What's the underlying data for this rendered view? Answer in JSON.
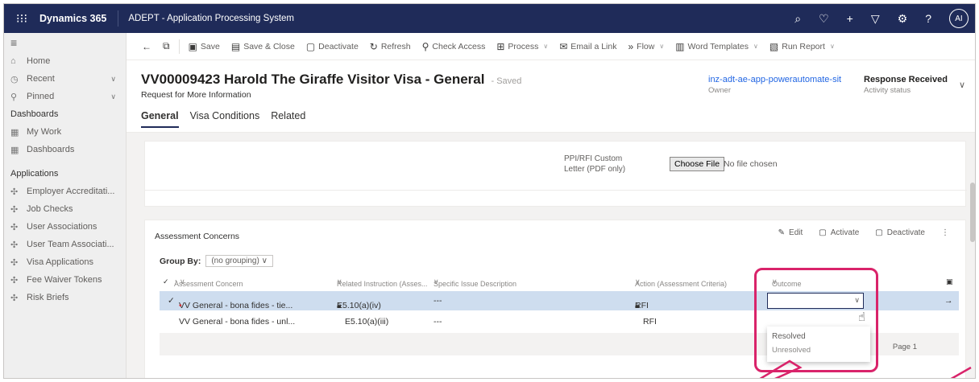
{
  "topbar": {
    "brand": "Dynamics 365",
    "app_name": "ADEPT - Application Processing System",
    "avatar_initials": "AI"
  },
  "nav": {
    "home": "Home",
    "recent": "Recent",
    "pinned": "Pinned",
    "dashboards_heading": "Dashboards",
    "my_work": "My Work",
    "dashboards": "Dashboards",
    "applications_heading": "Applications",
    "items": [
      "Employer Accreditati...",
      "Job Checks",
      "User Associations",
      "User Team Associati...",
      "Visa Applications",
      "Fee Waiver Tokens",
      "Risk Briefs"
    ]
  },
  "commands": {
    "save": "Save",
    "save_close": "Save & Close",
    "deactivate": "Deactivate",
    "refresh": "Refresh",
    "check_access": "Check Access",
    "process": "Process",
    "email_link": "Email a Link",
    "flow": "Flow",
    "word_templates": "Word Templates",
    "run_report": "Run Report"
  },
  "header": {
    "title": "VV00009423 Harold The Giraffe Visitor Visa - General",
    "saved": "- Saved",
    "subtitle": "Request for More Information",
    "owner_value": "inz-adt-ae-app-powerautomate-sit",
    "owner_label": "Owner",
    "status_value": "Response Received",
    "status_label": "Activity status"
  },
  "tabs": [
    "General",
    "Visa Conditions",
    "Related"
  ],
  "form": {
    "ppi_label_1": "PPI/RFI Custom",
    "ppi_label_2": "Letter (PDF only)",
    "choose_file": "Choose File",
    "no_file": "No file chosen"
  },
  "grid": {
    "title": "Assessment Concerns",
    "edit": "Edit",
    "activate": "Activate",
    "deactivate": "Deactivate",
    "group_by_label": "Group By:",
    "group_by_value": "(no grouping)",
    "columns": {
      "concern": "Assessment Concern",
      "instruction": "Related Instruction (Asses...",
      "description": "Specific Issue Description",
      "action": "Action (Assessment Criteria)",
      "outcome": "Outcome"
    },
    "rows": [
      {
        "concern": "VV General - bona fides - tie...",
        "instruction": "E5.10(a)(iv)",
        "description": "---",
        "action": "RFI"
      },
      {
        "concern": "VV General - bona fides - unl...",
        "instruction": "E5.10(a)(iii)",
        "description": "---",
        "action": "RFI"
      }
    ],
    "page": "Page 1",
    "outcome_options": [
      "Resolved",
      "Unresolved"
    ]
  },
  "colors": {
    "topbar": "#1f2b59",
    "selected_row": "#ceddef",
    "highlight": "#d9236a",
    "link": "#2266e3"
  }
}
